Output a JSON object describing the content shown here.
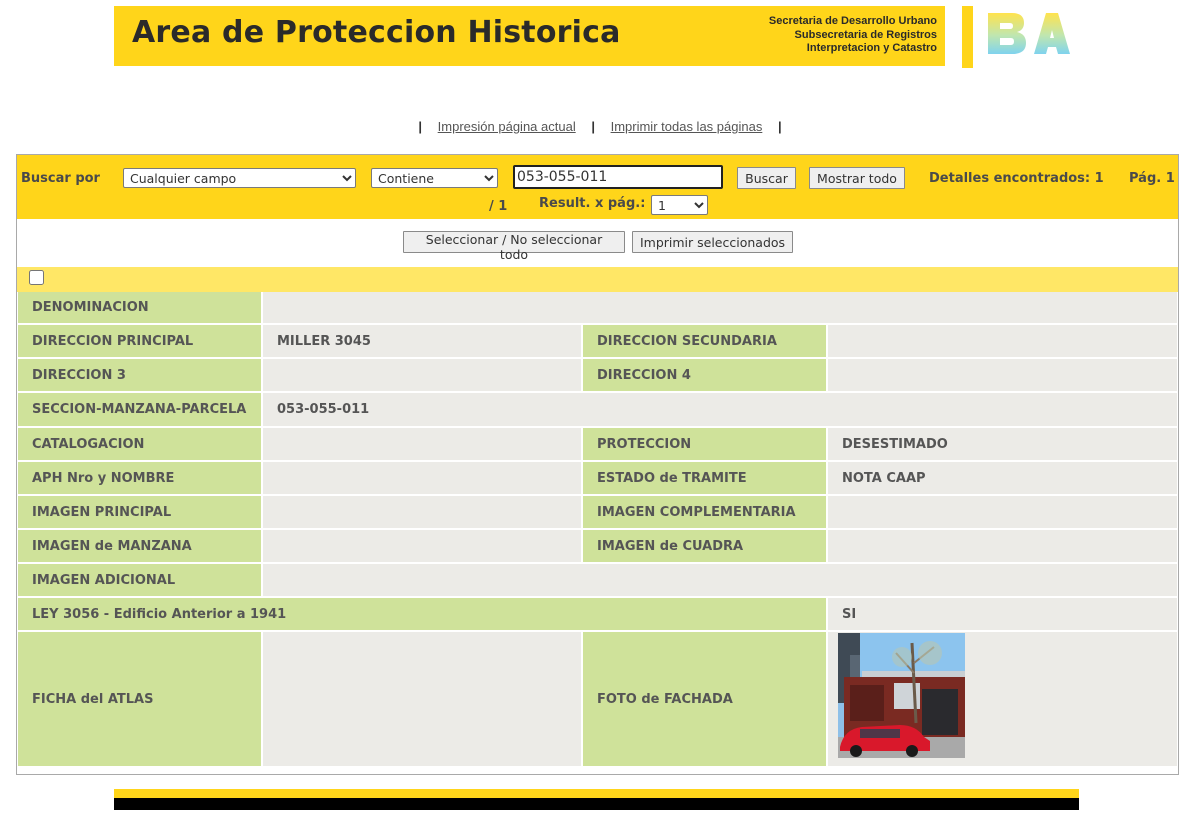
{
  "header": {
    "title": "Area de Proteccion Historica",
    "sub1": "Secretaria de Desarrollo Urbano",
    "sub2": "Subsecretaria de Registros",
    "sub3": "Interpretacion y Catastro",
    "logo_text": "BA"
  },
  "print": {
    "current_page": "Impresión página actual",
    "all_pages": "Imprimir todas las páginas",
    "separator": "|"
  },
  "search": {
    "label": "Buscar por",
    "field_value": "Cualquier campo",
    "operator_value": "Contiene",
    "query": "053-055-011",
    "buscar_label": "Buscar",
    "mostrar_label": "Mostrar todo",
    "found_text": "Detalles encontrados: 1",
    "page_text": "Pág. 1",
    "page_total": "/ 1",
    "rxp_label": "Result. x pág.:",
    "rxp_value": "1"
  },
  "actions": {
    "select_all": "Seleccionar / No seleccionar todo",
    "print_selected": "Imprimir seleccionados"
  },
  "record": {
    "denominacion_label": "DENOMINACION",
    "denominacion_value": "",
    "dir_principal_label": "DIRECCION PRINCIPAL",
    "dir_principal_value": "MILLER 3045",
    "dir_secundaria_label": "DIRECCION SECUNDARIA",
    "dir_secundaria_value": "",
    "dir3_label": "DIRECCION 3",
    "dir3_value": "",
    "dir4_label": "DIRECCION 4",
    "dir4_value": "",
    "smp_label": "SECCION-MANZANA-PARCELA",
    "smp_value": "053-055-011",
    "catalogacion_label": "CATALOGACION",
    "catalogacion_value": "",
    "proteccion_label": "PROTECCION",
    "proteccion_value": "DESESTIMADO",
    "aph_label": "APH Nro y NOMBRE",
    "aph_value": "",
    "estado_label": "ESTADO de TRAMITE",
    "estado_value": "NOTA CAAP",
    "img_principal_label": "IMAGEN PRINCIPAL",
    "img_principal_value": "",
    "img_complementaria_label": "IMAGEN COMPLEMENTARIA",
    "img_complementaria_value": "",
    "img_manzana_label": "IMAGEN de MANZANA",
    "img_manzana_value": "",
    "img_cuadra_label": "IMAGEN de CUADRA",
    "img_cuadra_value": "",
    "img_adicional_label": "IMAGEN ADICIONAL",
    "img_adicional_value": "",
    "ley_label": "LEY 3056 - Edificio Anterior a 1941",
    "ley_value": "SI",
    "ficha_label": "FICHA del ATLAS",
    "ficha_value": "",
    "foto_label": "FOTO de FACHADA"
  },
  "colors": {
    "brand_yellow": "#ffd51a",
    "label_green": "#cfe29a",
    "value_gray": "#ecebe7"
  }
}
